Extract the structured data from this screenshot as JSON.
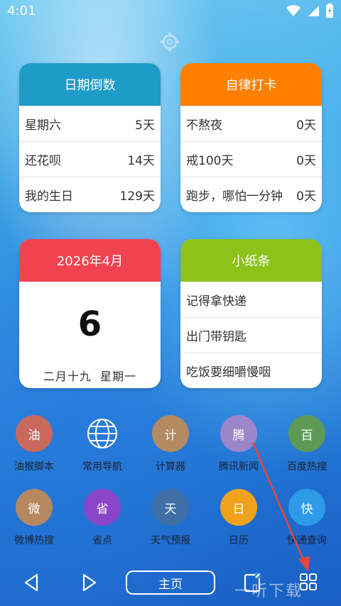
{
  "status_bar": {
    "time": "4:01"
  },
  "countdown_card": {
    "title": "日期倒数",
    "items": [
      {
        "label": "星期六",
        "value": "5天"
      },
      {
        "label": "还花呗",
        "value": "14天"
      },
      {
        "label": "我的生日",
        "value": "129天"
      }
    ]
  },
  "checkin_card": {
    "title": "自律打卡",
    "items": [
      {
        "label": "不熬夜",
        "value": "0天"
      },
      {
        "label": "戒100天",
        "value": "0天"
      },
      {
        "label": "跑步，哪怕一分钟",
        "value": "0天"
      }
    ]
  },
  "calendar_card": {
    "month": "2026年4月",
    "day": "6",
    "lunar": "二月十九  星期一"
  },
  "notes_card": {
    "title": "小纸条",
    "items": [
      "记得拿快递",
      "出门带钥匙",
      "吃饭要细嚼慢咽"
    ]
  },
  "apps": [
    {
      "glyph": "油",
      "label": "油猴脚本",
      "color": "#c9695d"
    },
    {
      "glyph": "",
      "label": "常用导航",
      "color": ""
    },
    {
      "glyph": "计",
      "label": "计算器",
      "color": "#b48a62"
    },
    {
      "glyph": "腾",
      "label": "腾讯新闻",
      "color": "#9b86c9"
    },
    {
      "glyph": "百",
      "label": "百度热搜",
      "color": "#5e9a56"
    },
    {
      "glyph": "微",
      "label": "微博热搜",
      "color": "#b58860"
    },
    {
      "glyph": "省",
      "label": "省点",
      "color": "#8a45c8"
    },
    {
      "glyph": "天",
      "label": "天气预报",
      "color": "#3f6fa6"
    },
    {
      "glyph": "日",
      "label": "日历",
      "color": "#f0a21c"
    },
    {
      "glyph": "快",
      "label": "快递查询",
      "color": "#2f9be8"
    }
  ],
  "nav": {
    "home_label": "主页"
  },
  "watermark": "一听下载",
  "colors": {
    "countdown_header": "#1f9bc7",
    "checkin_header": "#ff7f00",
    "calendar_header": "#f0434f",
    "notes_header": "#8cc21a",
    "arrow": "#e8453c"
  }
}
